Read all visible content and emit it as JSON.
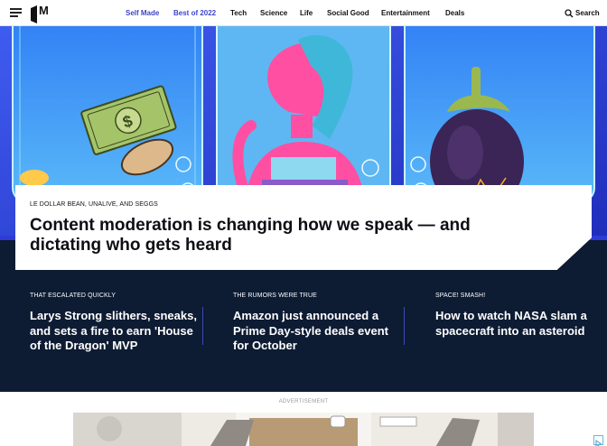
{
  "header": {
    "logo_letter": "M",
    "nav": [
      {
        "label": "Self Made",
        "accent": true
      },
      {
        "label": "Best of 2022",
        "accent": true
      },
      {
        "label": "Tech",
        "accent": false
      },
      {
        "label": "Science",
        "accent": false
      },
      {
        "label": "Life",
        "accent": false
      },
      {
        "label": "Social Good",
        "accent": false
      },
      {
        "label": "Entertainment",
        "accent": false
      },
      {
        "label": "Deals",
        "accent": false
      }
    ],
    "search_label": "Search",
    "icons": [
      "hamburger-menu-icon",
      "mashable-logo",
      "search-icon"
    ]
  },
  "feature": {
    "kicker": "LE DOLLAR BEAN, UNALIVE, AND SEGGS",
    "headline": "Content moderation is changing how we speak — and dictating who gets heard"
  },
  "stories": [
    {
      "kicker": "THAT ESCALATED QUICKLY",
      "title": "Larys Strong slithers, sneaks, and sets a fire to earn 'House of the Dragon' MVP"
    },
    {
      "kicker": "THE RUMORS WERE TRUE",
      "title": "Amazon just announced a Prime Day-style deals event for October"
    },
    {
      "kicker": "SPACE! SMASH!",
      "title": "How to watch NASA slam a spacecraft into an asteroid"
    }
  ],
  "ad": {
    "label": "ADVERTISEMENT"
  },
  "colors": {
    "hero_blue": "#2d3bd8",
    "dark_navy": "#0d1b33",
    "accent_nav": "#3d46c9",
    "phone_teal": "#7be3f0",
    "pink": "#ff4fa3"
  }
}
